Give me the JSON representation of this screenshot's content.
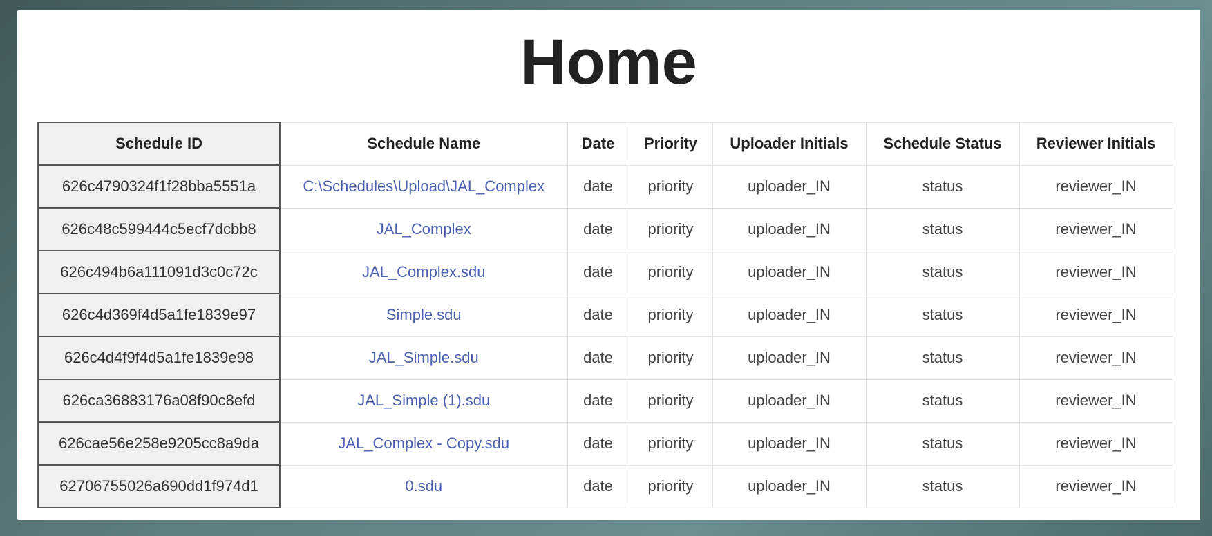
{
  "page": {
    "title": "Home"
  },
  "table": {
    "columns": [
      "Schedule ID",
      "Schedule Name",
      "Date",
      "Priority",
      "Uploader Initials",
      "Schedule Status",
      "Reviewer Initials"
    ],
    "rows": [
      [
        "626c4790324f1f28bba5551a",
        "C:\\Schedules\\Upload\\JAL_Complex",
        "date",
        "priority",
        "uploader_IN",
        "status",
        "reviewer_IN"
      ],
      [
        "626c48c599444c5ecf7dcbb8",
        "JAL_Complex",
        "date",
        "priority",
        "uploader_IN",
        "status",
        "reviewer_IN"
      ],
      [
        "626c494b6a111091d3c0c72c",
        "JAL_Complex.sdu",
        "date",
        "priority",
        "uploader_IN",
        "status",
        "reviewer_IN"
      ],
      [
        "626c4d369f4d5a1fe1839e97",
        "Simple.sdu",
        "date",
        "priority",
        "uploader_IN",
        "status",
        "reviewer_IN"
      ],
      [
        "626c4d4f9f4d5a1fe1839e98",
        "JAL_Simple.sdu",
        "date",
        "priority",
        "uploader_IN",
        "status",
        "reviewer_IN"
      ],
      [
        "626ca36883176a08f90c8efd",
        "JAL_Simple (1).sdu",
        "date",
        "priority",
        "uploader_IN",
        "status",
        "reviewer_IN"
      ],
      [
        "626cae56e258e9205cc8a9da",
        "JAL_Complex - Copy.sdu",
        "date",
        "priority",
        "uploader_IN",
        "status",
        "reviewer_IN"
      ],
      [
        "62706755026a690dd1f974d1",
        "0.sdu",
        "date",
        "priority",
        "uploader_IN",
        "status",
        "reviewer_IN"
      ]
    ]
  },
  "colors": {
    "link": "#4a5fb0",
    "id_column_bg": "#f0f0f0"
  }
}
